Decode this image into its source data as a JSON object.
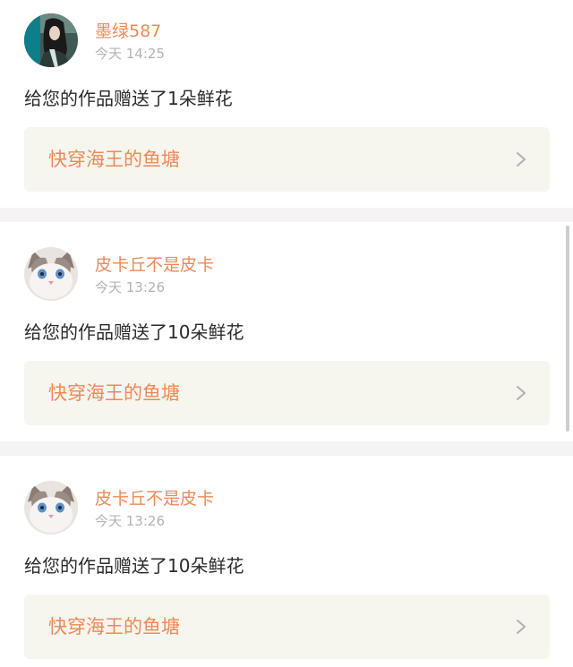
{
  "colors": {
    "accent": "#ec8a58",
    "time": "#b3b3b3",
    "text": "#2b2b2b",
    "link_bg": "#f6f5ee",
    "separator": "#f5f3f3"
  },
  "notifications": [
    {
      "username": "墨绿587",
      "time": "今天 14:25",
      "message": "给您的作品赠送了1朵鲜花",
      "work_title": "快穿海王的鱼塘",
      "avatar_icon": "anime-character-avatar-icon",
      "arrow_icon": "chevron-right-icon"
    },
    {
      "username": "皮卡丘不是皮卡",
      "time": "今天 13:26",
      "message": "给您的作品赠送了10朵鲜花",
      "work_title": "快穿海王的鱼塘",
      "avatar_icon": "cat-avatar-icon",
      "arrow_icon": "chevron-right-icon"
    },
    {
      "username": "皮卡丘不是皮卡",
      "time": "今天 13:26",
      "message": "给您的作品赠送了10朵鲜花",
      "work_title": "快穿海王的鱼塘",
      "avatar_icon": "cat-avatar-icon",
      "arrow_icon": "chevron-right-icon"
    }
  ]
}
